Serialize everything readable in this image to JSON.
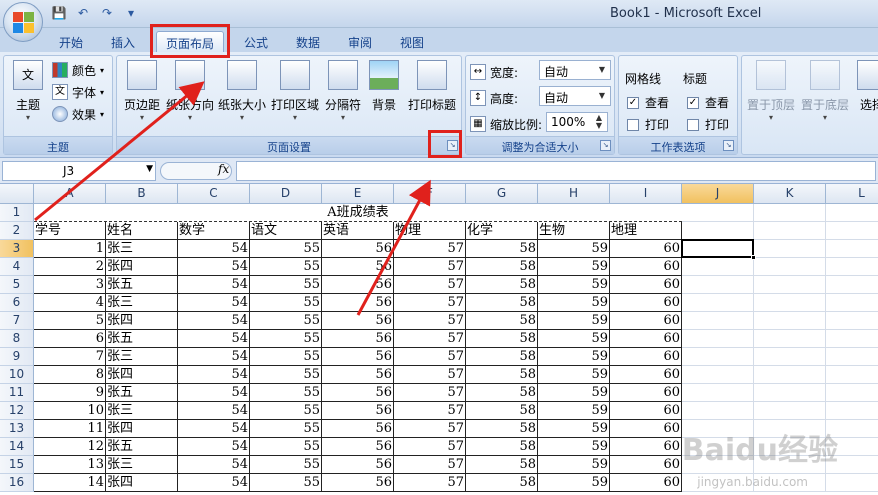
{
  "window": {
    "title": "Book1 - Microsoft Excel"
  },
  "tabs": [
    {
      "label": "开始",
      "active": false
    },
    {
      "label": "插入",
      "active": false
    },
    {
      "label": "页面布局",
      "active": true
    },
    {
      "label": "公式",
      "active": false
    },
    {
      "label": "数据",
      "active": false
    },
    {
      "label": "审阅",
      "active": false
    },
    {
      "label": "视图",
      "active": false
    }
  ],
  "ribbon": {
    "themes": {
      "label": "主题",
      "big": "主题",
      "colors": "颜色",
      "fonts": "字体",
      "effects": "效果"
    },
    "page_setup": {
      "label": "页面设置",
      "margins": "页边距",
      "orientation": "纸张方向",
      "size": "纸张大小",
      "print_area": "打印区域",
      "breaks": "分隔符",
      "background": "背景",
      "print_titles": "打印标题"
    },
    "scale": {
      "label": "调整为合适大小",
      "width_label": "宽度:",
      "width_value": "自动",
      "height_label": "高度:",
      "height_value": "自动",
      "scale_label": "缩放比例:",
      "scale_value": "100%"
    },
    "sheet_options": {
      "label": "工作表选项",
      "gridlines": "网格线",
      "headings": "标题",
      "view": "查看",
      "print": "打印"
    },
    "arrange": {
      "bring_front": "置于顶层",
      "send_back": "置于底层",
      "selection": "选择"
    }
  },
  "formula_bar": {
    "name_box": "J3",
    "fx": "fx",
    "formula": ""
  },
  "columns": [
    "A",
    "B",
    "C",
    "D",
    "E",
    "F",
    "G",
    "H",
    "I",
    "J",
    "K",
    "L"
  ],
  "rows": [
    "1",
    "2",
    "3",
    "4",
    "5",
    "6",
    "7",
    "8",
    "9",
    "10",
    "11",
    "12",
    "13",
    "14",
    "15",
    "16"
  ],
  "sheet": {
    "title": "A班成绩表",
    "headers": [
      "学号",
      "姓名",
      "数学",
      "语文",
      "英语",
      "物理",
      "化学",
      "生物",
      "地理"
    ],
    "data": [
      [
        "1",
        "张三",
        "54",
        "55",
        "56",
        "57",
        "58",
        "59",
        "60"
      ],
      [
        "2",
        "张四",
        "54",
        "55",
        "56",
        "57",
        "58",
        "59",
        "60"
      ],
      [
        "3",
        "张五",
        "54",
        "55",
        "56",
        "57",
        "58",
        "59",
        "60"
      ],
      [
        "4",
        "张三",
        "54",
        "55",
        "56",
        "57",
        "58",
        "59",
        "60"
      ],
      [
        "5",
        "张四",
        "54",
        "55",
        "56",
        "57",
        "58",
        "59",
        "60"
      ],
      [
        "6",
        "张五",
        "54",
        "55",
        "56",
        "57",
        "58",
        "59",
        "60"
      ],
      [
        "7",
        "张三",
        "54",
        "55",
        "56",
        "57",
        "58",
        "59",
        "60"
      ],
      [
        "8",
        "张四",
        "54",
        "55",
        "56",
        "57",
        "58",
        "59",
        "60"
      ],
      [
        "9",
        "张五",
        "54",
        "55",
        "56",
        "57",
        "58",
        "59",
        "60"
      ],
      [
        "10",
        "张三",
        "54",
        "55",
        "56",
        "57",
        "58",
        "59",
        "60"
      ],
      [
        "11",
        "张四",
        "54",
        "55",
        "56",
        "57",
        "58",
        "59",
        "60"
      ],
      [
        "12",
        "张五",
        "54",
        "55",
        "56",
        "57",
        "58",
        "59",
        "60"
      ],
      [
        "13",
        "张三",
        "54",
        "55",
        "56",
        "57",
        "58",
        "59",
        "60"
      ],
      [
        "14",
        "张四",
        "54",
        "55",
        "56",
        "57",
        "58",
        "59",
        "60"
      ]
    ]
  },
  "active_cell": "J3",
  "colors": {
    "annotation": "#e0211c",
    "ribbon": "#d6e3f3",
    "selected_header": "#f1c15f"
  },
  "watermark": {
    "main": "Baidu经验",
    "sub": "jingyan.baidu.com"
  }
}
